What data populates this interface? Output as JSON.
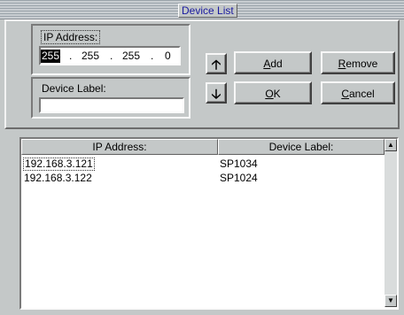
{
  "window": {
    "title": "Device List"
  },
  "form": {
    "ip_label": "IP Address:",
    "ip_segments": [
      "255",
      "255",
      "255",
      "0"
    ],
    "ip_separator": ".",
    "device_label": "Device Label:",
    "device_label_value": ""
  },
  "buttons": {
    "up_icon": "up-arrow-icon",
    "down_icon": "down-arrow-icon",
    "add_pre": "",
    "add_u": "A",
    "add_post": "dd",
    "remove_pre": "",
    "remove_u": "R",
    "remove_post": "emove",
    "ok_pre": "",
    "ok_u": "O",
    "ok_post": "K",
    "cancel_pre": "",
    "cancel_u": "C",
    "cancel_post": "ancel"
  },
  "list": {
    "columns": [
      "IP Address:",
      "Device Label:"
    ],
    "rows": [
      {
        "ip": "192.168.3.121",
        "label": "SP1034"
      },
      {
        "ip": "192.168.3.122",
        "label": "SP1024"
      }
    ]
  }
}
